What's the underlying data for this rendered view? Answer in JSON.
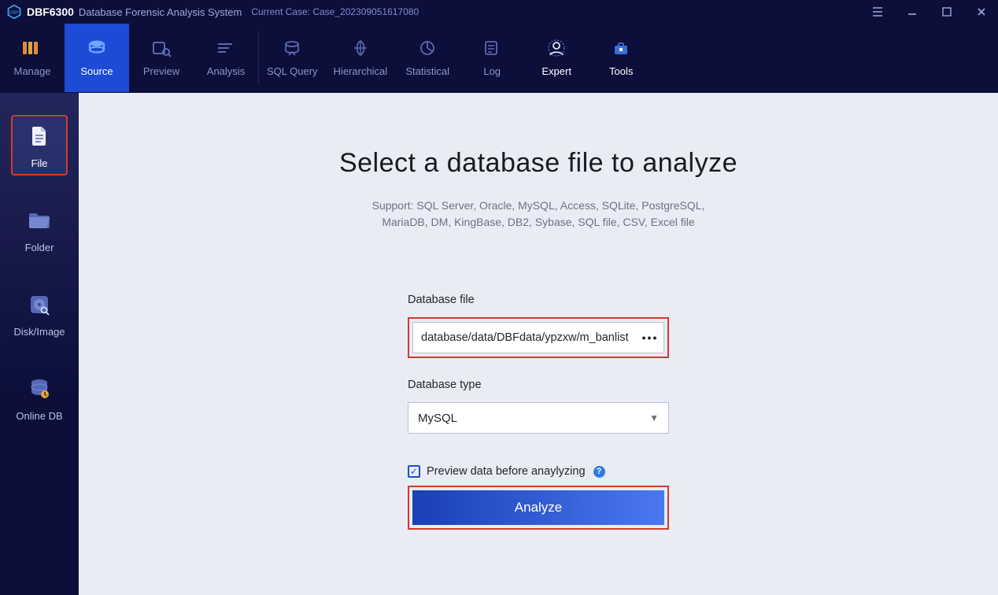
{
  "app": {
    "brand": "DBF6300",
    "subtitle": "Database Forensic Analysis System",
    "case_label": "Current Case: Case_202309051617080"
  },
  "toptabs": {
    "manage": "Manage",
    "source": "Source",
    "preview": "Preview",
    "analysis": "Analysis",
    "sqlquery": "SQL Query",
    "hierarchical": "Hierarchical",
    "statistical": "Statistical",
    "log": "Log",
    "expert": "Expert",
    "tools": "Tools",
    "active": "source"
  },
  "sidebar": {
    "file": "File",
    "folder": "Folder",
    "diskimage": "Disk/Image",
    "onlinedb": "Online DB",
    "active": "file"
  },
  "main": {
    "heading": "Select a database file to analyze",
    "support_line1": "Support: SQL Server, Oracle, MySQL, Access, SQLite, PostgreSQL,",
    "support_line2": "MariaDB, DM, KingBase, DB2, Sybase, SQL file, CSV, Excel file",
    "db_file_label": "Database file",
    "db_file_value": "database/data/DBFdata/ypzxw/m_banlists.frm",
    "browse_glyph": "•••",
    "db_type_label": "Database type",
    "db_type_value": "MySQL",
    "preview_checkbox_label": "Preview data before anaylyzing",
    "preview_checked": true,
    "analyze_label": "Analyze"
  },
  "icons": {
    "caret": "▼",
    "check": "✓",
    "help": "?"
  }
}
